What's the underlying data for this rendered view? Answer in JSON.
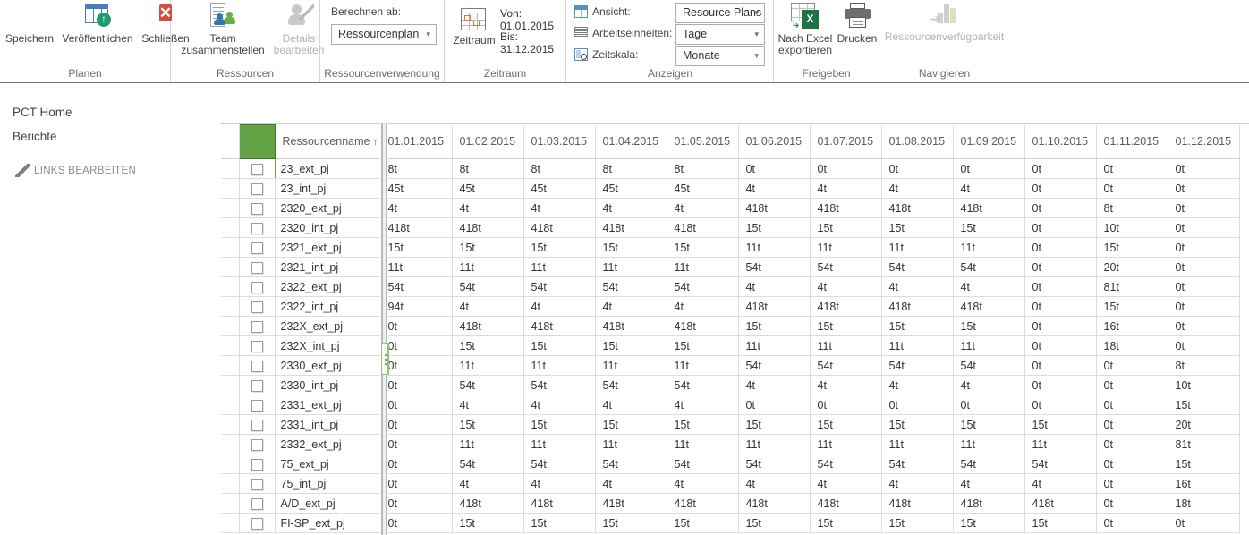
{
  "ribbon": {
    "groups": [
      {
        "name": "Planen",
        "label": "Planen"
      },
      {
        "name": "Ressourcen",
        "label": "Ressourcen"
      },
      {
        "name": "Ressourcenverwendung",
        "label": "Ressourcenverwendung"
      },
      {
        "name": "Zeitraum",
        "label": "Zeitraum"
      },
      {
        "name": "Anzeigen",
        "label": "Anzeigen"
      },
      {
        "name": "Freigeben",
        "label": "Freigeben"
      },
      {
        "name": "Navigieren",
        "label": "Navigieren"
      }
    ],
    "planen": {
      "save": "Speichern",
      "publish": "Veröffentlichen",
      "close": "Schließen"
    },
    "ressourcen": {
      "build_team_line1": "Team",
      "build_team_line2": "zusammenstellen",
      "edit_details_line1": "Details",
      "edit_details_line2": "bearbeiten"
    },
    "ressourcenverwendung": {
      "calc_from_label": "Berechnen ab:",
      "calc_from_value": "Ressourcenplan"
    },
    "zeitraum": {
      "button_label": "Zeitraum",
      "from": "Von: 01.01.2015",
      "to": "Bis: 31.12.2015"
    },
    "anzeigen": {
      "view_label": "Ansicht:",
      "view_value": "Resource Plans",
      "units_label": "Arbeitseinheiten:",
      "units_value": "Tage",
      "timescale_label": "Zeitskala:",
      "timescale_value": "Monate"
    },
    "freigeben": {
      "export_excel_line1": "Nach Excel",
      "export_excel_line2": "exportieren",
      "print": "Drucken"
    },
    "navigieren": {
      "resource_availability": "Ressourcenverfügbarkeit"
    }
  },
  "leftnav": {
    "items": [
      {
        "label": "PCT Home"
      },
      {
        "label": "Berichte"
      }
    ],
    "edit_links": "LINKS BEARBEITEN"
  },
  "grid": {
    "name_header": "Ressourcenname",
    "sort_indicator": "↑",
    "date_headers": [
      "01.01.2015",
      "01.02.2015",
      "01.03.2015",
      "01.04.2015",
      "01.05.2015",
      "01.06.2015",
      "01.07.2015",
      "01.08.2015",
      "01.09.2015",
      "01.10.2015",
      "01.11.2015",
      "01.12.2015"
    ],
    "rows": [
      {
        "name": "23_ext_pj",
        "values": [
          "8t",
          "8t",
          "8t",
          "8t",
          "8t",
          "0t",
          "0t",
          "0t",
          "0t",
          "0t",
          "0t",
          "0t"
        ]
      },
      {
        "name": "23_int_pj",
        "values": [
          "45t",
          "45t",
          "45t",
          "45t",
          "45t",
          "4t",
          "4t",
          "4t",
          "4t",
          "0t",
          "0t",
          "0t"
        ]
      },
      {
        "name": "2320_ext_pj",
        "values": [
          "4t",
          "4t",
          "4t",
          "4t",
          "4t",
          "418t",
          "418t",
          "418t",
          "418t",
          "0t",
          "8t",
          "0t"
        ]
      },
      {
        "name": "2320_int_pj",
        "values": [
          "418t",
          "418t",
          "418t",
          "418t",
          "418t",
          "15t",
          "15t",
          "15t",
          "15t",
          "0t",
          "10t",
          "0t"
        ]
      },
      {
        "name": "2321_ext_pj",
        "values": [
          "15t",
          "15t",
          "15t",
          "15t",
          "15t",
          "11t",
          "11t",
          "11t",
          "11t",
          "0t",
          "15t",
          "0t"
        ]
      },
      {
        "name": "2321_int_pj",
        "values": [
          "11t",
          "11t",
          "11t",
          "11t",
          "11t",
          "54t",
          "54t",
          "54t",
          "54t",
          "0t",
          "20t",
          "0t"
        ]
      },
      {
        "name": "2322_ext_pj",
        "values": [
          "54t",
          "54t",
          "54t",
          "54t",
          "54t",
          "4t",
          "4t",
          "4t",
          "4t",
          "0t",
          "81t",
          "0t"
        ]
      },
      {
        "name": "2322_int_pj",
        "values": [
          "94t",
          "4t",
          "4t",
          "4t",
          "4t",
          "418t",
          "418t",
          "418t",
          "418t",
          "0t",
          "15t",
          "0t"
        ]
      },
      {
        "name": "232X_ext_pj",
        "values": [
          "0t",
          "418t",
          "418t",
          "418t",
          "418t",
          "15t",
          "15t",
          "15t",
          "15t",
          "0t",
          "16t",
          "0t"
        ]
      },
      {
        "name": "232X_int_pj",
        "values": [
          "0t",
          "15t",
          "15t",
          "15t",
          "15t",
          "11t",
          "11t",
          "11t",
          "11t",
          "0t",
          "18t",
          "0t"
        ]
      },
      {
        "name": "2330_ext_pj",
        "values": [
          "0t",
          "11t",
          "11t",
          "11t",
          "11t",
          "54t",
          "54t",
          "54t",
          "54t",
          "0t",
          "0t",
          "8t"
        ]
      },
      {
        "name": "2330_int_pj",
        "values": [
          "0t",
          "54t",
          "54t",
          "54t",
          "54t",
          "4t",
          "4t",
          "4t",
          "4t",
          "0t",
          "0t",
          "10t"
        ]
      },
      {
        "name": "2331_ext_pj",
        "values": [
          "0t",
          "4t",
          "4t",
          "4t",
          "4t",
          "0t",
          "0t",
          "0t",
          "0t",
          "0t",
          "0t",
          "15t"
        ]
      },
      {
        "name": "2331_int_pj",
        "values": [
          "0t",
          "15t",
          "15t",
          "15t",
          "15t",
          "15t",
          "15t",
          "15t",
          "15t",
          "15t",
          "0t",
          "20t"
        ]
      },
      {
        "name": "2332_ext_pj",
        "values": [
          "0t",
          "11t",
          "11t",
          "11t",
          "11t",
          "11t",
          "11t",
          "11t",
          "11t",
          "11t",
          "0t",
          "81t"
        ]
      },
      {
        "name": "75_ext_pj",
        "values": [
          "0t",
          "54t",
          "54t",
          "54t",
          "54t",
          "54t",
          "54t",
          "54t",
          "54t",
          "54t",
          "0t",
          "15t"
        ]
      },
      {
        "name": "75_int_pj",
        "values": [
          "0t",
          "4t",
          "4t",
          "4t",
          "4t",
          "4t",
          "4t",
          "4t",
          "4t",
          "4t",
          "0t",
          "16t"
        ]
      },
      {
        "name": "A/D_ext_pj",
        "values": [
          "0t",
          "418t",
          "418t",
          "418t",
          "418t",
          "418t",
          "418t",
          "418t",
          "418t",
          "418t",
          "0t",
          "18t"
        ]
      },
      {
        "name": "FI-SP_ext_pj",
        "values": [
          "0t",
          "15t",
          "15t",
          "15t",
          "15t",
          "15t",
          "15t",
          "15t",
          "15t",
          "15t",
          "0t",
          "0t"
        ]
      }
    ]
  },
  "colors": {
    "ribbon_accent": "#8064a2",
    "header_green": "#62a244",
    "excel_green": "#1f7244",
    "close_red": "#d64c40"
  }
}
